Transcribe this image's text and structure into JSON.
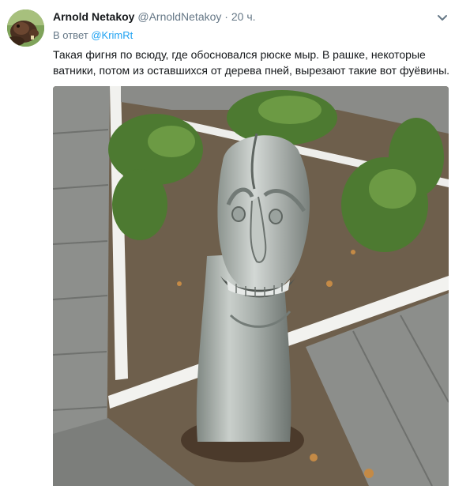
{
  "tweet": {
    "author": {
      "name": "Arnold Netakoy",
      "handle": "@ArnoldNetakoy",
      "separator": "·",
      "time": "20 ч."
    },
    "reply": {
      "prefix": "В ответ",
      "mention": "@KrimRt"
    },
    "text_lines": [
      "Такая фигня по всюду, где обосновался рюске мыр. В рашке, некоторые",
      "ватники, потом из оставшихся от дерева пней, вырезают такие вот фуёвины."
    ],
    "icons": {
      "avatar": "beaver-avatar",
      "menu": "chevron-down-icon"
    },
    "colors": {
      "text": "#14171a",
      "secondary": "#657786",
      "link": "#1da1f2"
    }
  }
}
